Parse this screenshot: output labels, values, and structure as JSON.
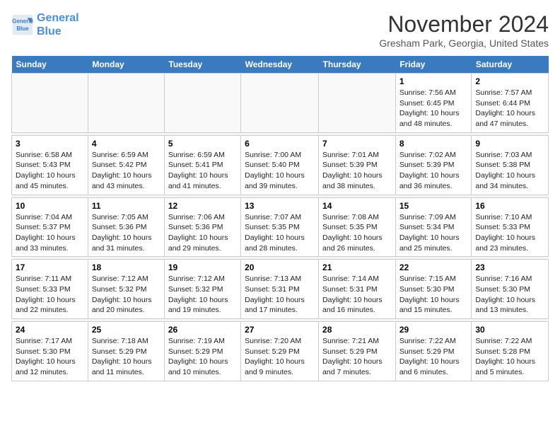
{
  "header": {
    "logo_line1": "General",
    "logo_line2": "Blue",
    "month": "November 2024",
    "location": "Gresham Park, Georgia, United States"
  },
  "days_of_week": [
    "Sunday",
    "Monday",
    "Tuesday",
    "Wednesday",
    "Thursday",
    "Friday",
    "Saturday"
  ],
  "weeks": [
    [
      {
        "day": "",
        "info": ""
      },
      {
        "day": "",
        "info": ""
      },
      {
        "day": "",
        "info": ""
      },
      {
        "day": "",
        "info": ""
      },
      {
        "day": "",
        "info": ""
      },
      {
        "day": "1",
        "info": "Sunrise: 7:56 AM\nSunset: 6:45 PM\nDaylight: 10 hours and 48 minutes."
      },
      {
        "day": "2",
        "info": "Sunrise: 7:57 AM\nSunset: 6:44 PM\nDaylight: 10 hours and 47 minutes."
      }
    ],
    [
      {
        "day": "3",
        "info": "Sunrise: 6:58 AM\nSunset: 5:43 PM\nDaylight: 10 hours and 45 minutes."
      },
      {
        "day": "4",
        "info": "Sunrise: 6:59 AM\nSunset: 5:42 PM\nDaylight: 10 hours and 43 minutes."
      },
      {
        "day": "5",
        "info": "Sunrise: 6:59 AM\nSunset: 5:41 PM\nDaylight: 10 hours and 41 minutes."
      },
      {
        "day": "6",
        "info": "Sunrise: 7:00 AM\nSunset: 5:40 PM\nDaylight: 10 hours and 39 minutes."
      },
      {
        "day": "7",
        "info": "Sunrise: 7:01 AM\nSunset: 5:39 PM\nDaylight: 10 hours and 38 minutes."
      },
      {
        "day": "8",
        "info": "Sunrise: 7:02 AM\nSunset: 5:39 PM\nDaylight: 10 hours and 36 minutes."
      },
      {
        "day": "9",
        "info": "Sunrise: 7:03 AM\nSunset: 5:38 PM\nDaylight: 10 hours and 34 minutes."
      }
    ],
    [
      {
        "day": "10",
        "info": "Sunrise: 7:04 AM\nSunset: 5:37 PM\nDaylight: 10 hours and 33 minutes."
      },
      {
        "day": "11",
        "info": "Sunrise: 7:05 AM\nSunset: 5:36 PM\nDaylight: 10 hours and 31 minutes."
      },
      {
        "day": "12",
        "info": "Sunrise: 7:06 AM\nSunset: 5:36 PM\nDaylight: 10 hours and 29 minutes."
      },
      {
        "day": "13",
        "info": "Sunrise: 7:07 AM\nSunset: 5:35 PM\nDaylight: 10 hours and 28 minutes."
      },
      {
        "day": "14",
        "info": "Sunrise: 7:08 AM\nSunset: 5:35 PM\nDaylight: 10 hours and 26 minutes."
      },
      {
        "day": "15",
        "info": "Sunrise: 7:09 AM\nSunset: 5:34 PM\nDaylight: 10 hours and 25 minutes."
      },
      {
        "day": "16",
        "info": "Sunrise: 7:10 AM\nSunset: 5:33 PM\nDaylight: 10 hours and 23 minutes."
      }
    ],
    [
      {
        "day": "17",
        "info": "Sunrise: 7:11 AM\nSunset: 5:33 PM\nDaylight: 10 hours and 22 minutes."
      },
      {
        "day": "18",
        "info": "Sunrise: 7:12 AM\nSunset: 5:32 PM\nDaylight: 10 hours and 20 minutes."
      },
      {
        "day": "19",
        "info": "Sunrise: 7:12 AM\nSunset: 5:32 PM\nDaylight: 10 hours and 19 minutes."
      },
      {
        "day": "20",
        "info": "Sunrise: 7:13 AM\nSunset: 5:31 PM\nDaylight: 10 hours and 17 minutes."
      },
      {
        "day": "21",
        "info": "Sunrise: 7:14 AM\nSunset: 5:31 PM\nDaylight: 10 hours and 16 minutes."
      },
      {
        "day": "22",
        "info": "Sunrise: 7:15 AM\nSunset: 5:30 PM\nDaylight: 10 hours and 15 minutes."
      },
      {
        "day": "23",
        "info": "Sunrise: 7:16 AM\nSunset: 5:30 PM\nDaylight: 10 hours and 13 minutes."
      }
    ],
    [
      {
        "day": "24",
        "info": "Sunrise: 7:17 AM\nSunset: 5:30 PM\nDaylight: 10 hours and 12 minutes."
      },
      {
        "day": "25",
        "info": "Sunrise: 7:18 AM\nSunset: 5:29 PM\nDaylight: 10 hours and 11 minutes."
      },
      {
        "day": "26",
        "info": "Sunrise: 7:19 AM\nSunset: 5:29 PM\nDaylight: 10 hours and 10 minutes."
      },
      {
        "day": "27",
        "info": "Sunrise: 7:20 AM\nSunset: 5:29 PM\nDaylight: 10 hours and 9 minutes."
      },
      {
        "day": "28",
        "info": "Sunrise: 7:21 AM\nSunset: 5:29 PM\nDaylight: 10 hours and 7 minutes."
      },
      {
        "day": "29",
        "info": "Sunrise: 7:22 AM\nSunset: 5:29 PM\nDaylight: 10 hours and 6 minutes."
      },
      {
        "day": "30",
        "info": "Sunrise: 7:22 AM\nSunset: 5:28 PM\nDaylight: 10 hours and 5 minutes."
      }
    ]
  ]
}
